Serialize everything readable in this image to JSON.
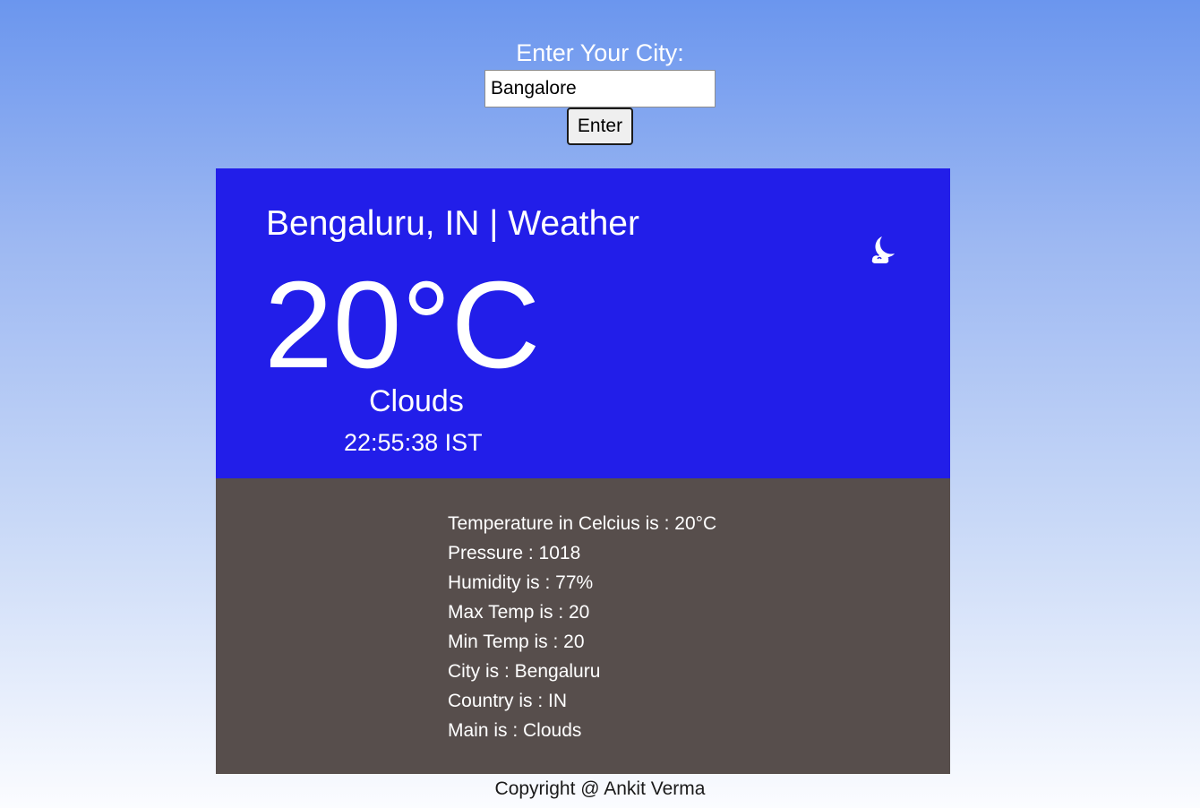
{
  "search": {
    "label": "Enter Your City:",
    "input_value": "Bangalore",
    "button_label": "Enter"
  },
  "weather": {
    "title": "Bengaluru, IN | Weather",
    "temperature": "20°C",
    "condition": "Clouds",
    "time": "22:55:38 IST",
    "icon": "moon-cloud-icon",
    "top_color": "#221ee9",
    "bottom_color": "#574e4c"
  },
  "details": [
    "Temperature in Celcius is : 20°C",
    "Pressure : 1018",
    "Humidity is : 77%",
    "Max Temp is : 20",
    "Min Temp is : 20",
    "City is : Bengaluru",
    "Country is : IN",
    "Main is : Clouds"
  ],
  "footer": {
    "text": "Copyright @ Ankit Verma"
  }
}
